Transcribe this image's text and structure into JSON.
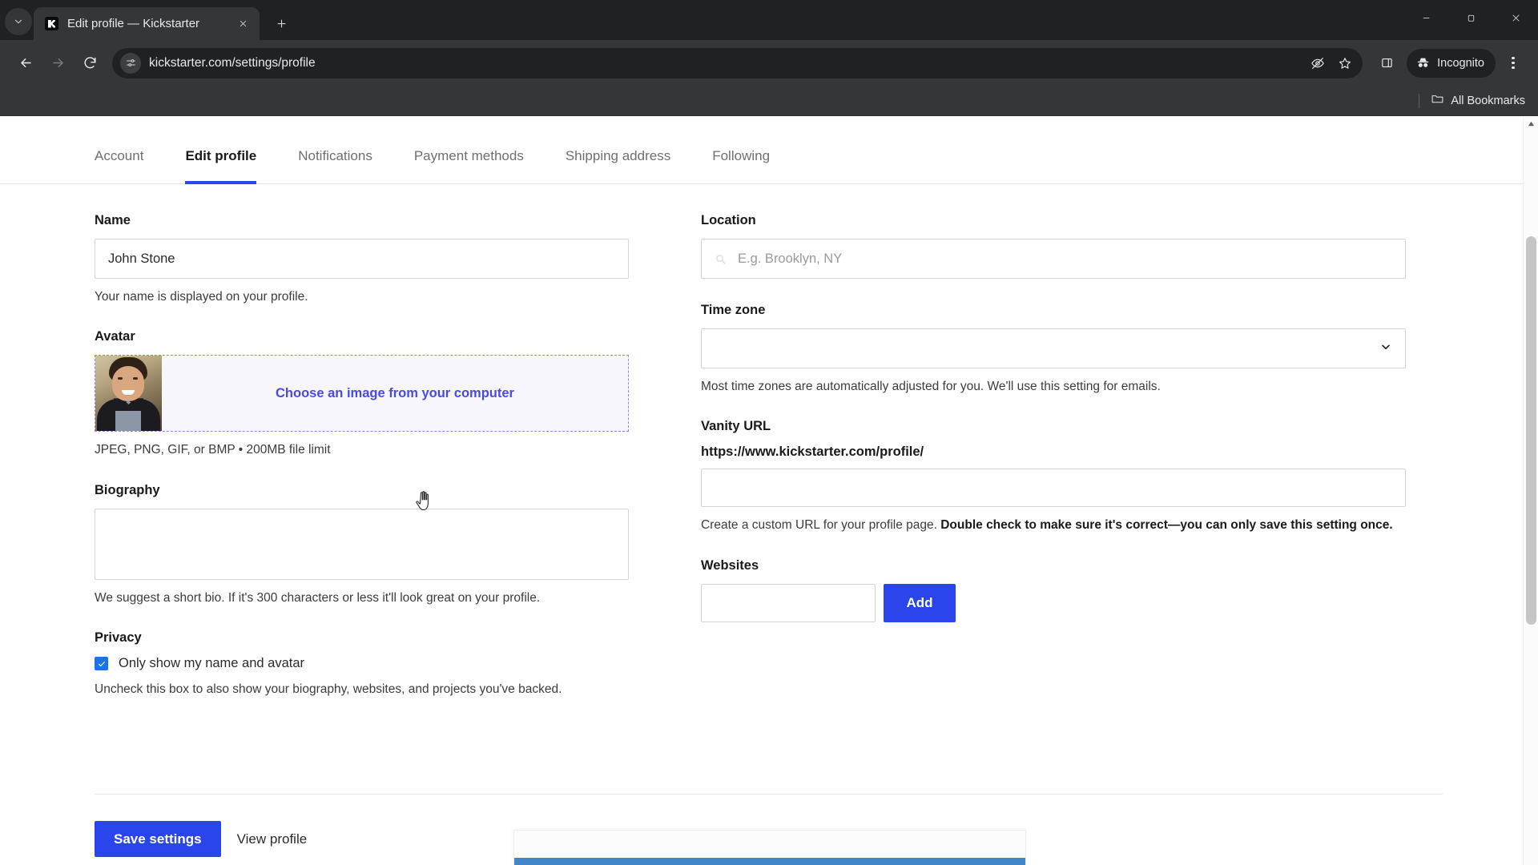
{
  "browser": {
    "tab": {
      "title": "Edit profile — Kickstarter",
      "favicon": "kickstarter-k-icon",
      "close": "close-icon"
    },
    "new_tab_label": "+",
    "omnibox": {
      "url": "kickstarter.com/settings/profile",
      "site_info_icon": "page-settings-icon",
      "tracking_protection_icon": "eye-slash-icon",
      "bookmark_icon": "star-icon"
    },
    "side_panel_icon": "side-panel-icon",
    "profile_pill_label": "Incognito",
    "menu_icon": "kebab-menu-icon",
    "window_controls": {
      "minimize": "minimize-icon",
      "maximize": "restore-icon",
      "close": "window-close-icon"
    },
    "bookmarks": {
      "all_bookmarks_label": "All Bookmarks",
      "folder_icon": "folder-icon"
    }
  },
  "nav": {
    "tabs": [
      {
        "label": "Account",
        "active": false
      },
      {
        "label": "Edit profile",
        "active": true
      },
      {
        "label": "Notifications",
        "active": false
      },
      {
        "label": "Payment methods",
        "active": false
      },
      {
        "label": "Shipping address",
        "active": false
      },
      {
        "label": "Following",
        "active": false
      }
    ]
  },
  "left": {
    "name": {
      "label": "Name",
      "value": "John Stone",
      "help": "Your name is displayed on your profile."
    },
    "avatar": {
      "label": "Avatar",
      "cta": "Choose an image from your computer",
      "help": "JPEG, PNG, GIF, or BMP • 200MB file limit"
    },
    "biography": {
      "label": "Biography",
      "value": "",
      "help": "We suggest a short bio. If it's 300 characters or less it'll look great on your profile."
    },
    "privacy": {
      "label": "Privacy",
      "checkbox_label": "Only show my name and avatar",
      "checked": true,
      "help": "Uncheck this box to also show your biography, websites, and projects you've backed."
    }
  },
  "right": {
    "location": {
      "label": "Location",
      "value": "",
      "placeholder": "E.g. Brooklyn, NY",
      "icon": "location-search-icon"
    },
    "timezone": {
      "label": "Time zone",
      "value": "",
      "help": "Most time zones are automatically adjusted for you. We'll use this setting for emails.",
      "chevron": "chevron-down-icon"
    },
    "vanity_url": {
      "label": "Vanity URL",
      "prefix": "https://www.kickstarter.com/profile/",
      "value": "",
      "help_plain": "Create a custom URL for your profile page. ",
      "help_bold": "Double check to make sure it's correct—you can only save this setting once."
    },
    "websites": {
      "label": "Websites",
      "value": "",
      "add_label": "Add"
    }
  },
  "footer": {
    "save_label": "Save settings",
    "view_profile_label": "View profile"
  },
  "colors": {
    "accent": "#2b45ed",
    "link": "#4a4ae0",
    "checkbox": "#1a73e8",
    "sheet_bar": "#4186ca"
  }
}
